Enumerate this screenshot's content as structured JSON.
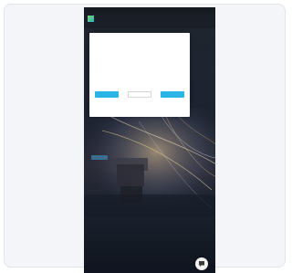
{
  "page": {
    "background_color": "#ffffff",
    "card_color": "#f4f5f8"
  },
  "website": {
    "topbar_links": "",
    "nav_items": [
      "",
      "",
      "",
      "",
      "",
      "",
      ""
    ],
    "hero_title": "",
    "hero_button_label": "",
    "accent_color": "#2bb4e6"
  },
  "consent": {
    "title": "",
    "body": "",
    "body_secondary": "",
    "buttons": {
      "settings": "",
      "necessary_only": "",
      "accept_all": ""
    }
  },
  "icons": {
    "logo": "brand-logo-icon",
    "chat": "chat-bubble-icon"
  }
}
